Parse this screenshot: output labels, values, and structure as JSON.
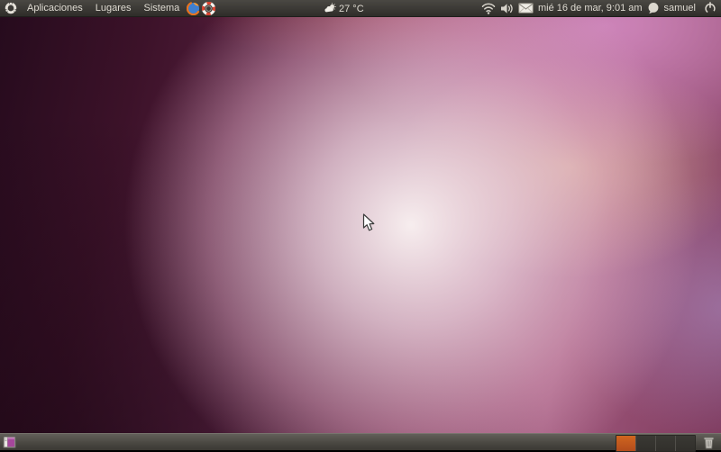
{
  "top_panel": {
    "menus": [
      {
        "label": "Aplicaciones"
      },
      {
        "label": "Lugares"
      },
      {
        "label": "Sistema"
      }
    ],
    "launcher_icons": [
      "firefox-icon",
      "help-lifebuoy-icon"
    ],
    "weather": {
      "temperature": "27 °C",
      "icon": "sun-cloud-icon"
    },
    "indicators": {
      "icons": [
        "wifi-icon",
        "volume-icon",
        "mail-icon"
      ],
      "clock": "mié 16 de mar, 9:01 am",
      "user_icon": "user-status-bubble-icon",
      "user": "samuel",
      "power_icon": "power-icon"
    }
  },
  "bottom_panel": {
    "show_desktop_icon": "show-desktop-icon",
    "workspace_switcher": {
      "count": 4,
      "active_index": 0
    },
    "trash_icon": "trash-icon"
  },
  "colors": {
    "panel_text": "#dfdbd2",
    "active_workspace": "#c4571e",
    "wallpaper_dark": "#260b1d",
    "wallpaper_glow": "#fdf7f6"
  }
}
